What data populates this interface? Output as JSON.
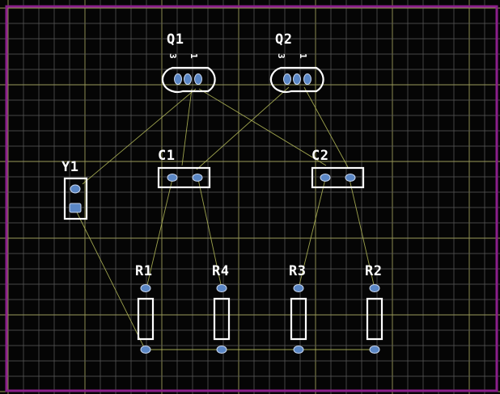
{
  "colors": {
    "background": "#050505",
    "grid": "#5d5d5d",
    "grid_major": "#9a9a5a",
    "board_outline": "#8b1f8b",
    "silkscreen": "#ffffff",
    "pad_fill": "#5a86c4",
    "ratsnest": "#b9be5a"
  },
  "components": {
    "Q1": {
      "ref": "Q1",
      "pin_labels": [
        "3",
        "1"
      ]
    },
    "Q2": {
      "ref": "Q2",
      "pin_labels": [
        "3",
        "1"
      ]
    },
    "Y1": {
      "ref": "Y1"
    },
    "C1": {
      "ref": "C1"
    },
    "C2": {
      "ref": "C2"
    },
    "R1": {
      "ref": "R1"
    },
    "R4": {
      "ref": "R4"
    },
    "R3": {
      "ref": "R3"
    },
    "R2": {
      "ref": "R2"
    }
  }
}
